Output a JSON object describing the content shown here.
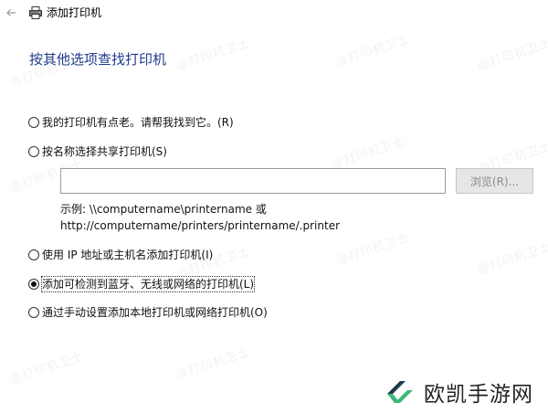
{
  "window": {
    "title": "添加打印机",
    "back_icon": "back-arrow-icon",
    "printer_icon": "printer-icon"
  },
  "heading": "按其他选项查找打印机",
  "options": [
    {
      "label": "我的打印机有点老。请帮我找到它。(R)",
      "selected": false
    },
    {
      "label": "按名称选择共享打印机(S)",
      "selected": false
    },
    {
      "label": "使用 IP 地址或主机名添加打印机(I)",
      "selected": false
    },
    {
      "label": "添加可检测到蓝牙、无线或网络的打印机(L)",
      "selected": true
    },
    {
      "label": "通过手动设置添加本地打印机或网络打印机(O)",
      "selected": false
    }
  ],
  "shared_printer": {
    "value": "",
    "browse_label": "浏览(R)...",
    "example_line1": "示例: \\\\computername\\printername 或",
    "example_line2": "http://computername/printers/printername/.printer"
  },
  "watermark_text": "@打印机卫士",
  "brand": {
    "name": "欧凯手游网",
    "colors": {
      "dark": "#1f3a4a",
      "green": "#3cb878"
    }
  }
}
